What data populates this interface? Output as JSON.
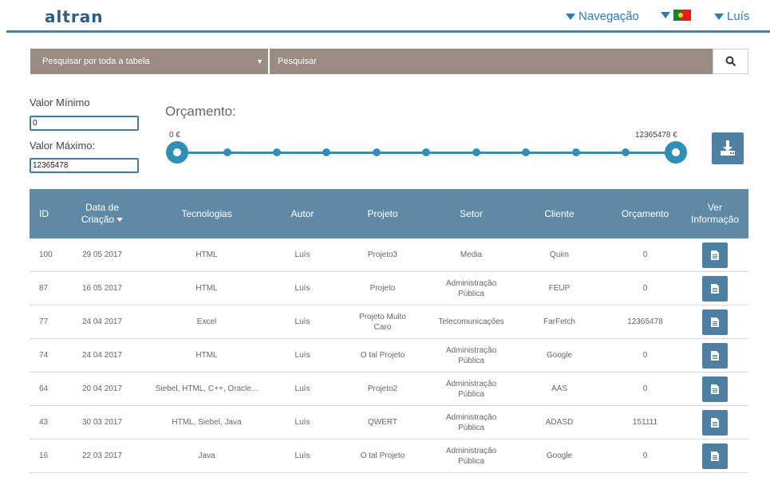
{
  "header": {
    "logo": "altran",
    "nav_label": "Navegação",
    "user_label": "Luís"
  },
  "search": {
    "scope_label": "Pesquisar por toda a tabela",
    "placeholder": "Pesquisar"
  },
  "filters": {
    "min_label": "Valor Mínimo",
    "min_value": "0",
    "max_label": "Valor Máximo:",
    "max_value": "12365478",
    "budget_title": "Orçamento:",
    "range_min_label": "0 €",
    "range_max_label": "12365478 €"
  },
  "table": {
    "columns": {
      "id": "ID",
      "date": "Data de Criação",
      "tech": "Tecnologias",
      "author": "Autor",
      "project": "Projeto",
      "sector": "Setor",
      "client": "Cliente",
      "budget": "Orçamento",
      "info": "Ver Informação"
    },
    "rows": [
      {
        "id": "100",
        "date": "29 05 2017",
        "tech": "HTML",
        "author": "Luís",
        "project": "Projeto3",
        "sector": "Media",
        "client": "Quim",
        "budget": "0"
      },
      {
        "id": "87",
        "date": "16 05 2017",
        "tech": "HTML",
        "author": "Luís",
        "project": "Projeto",
        "sector": "Administração Pública",
        "client": "FEUP",
        "budget": "0"
      },
      {
        "id": "77",
        "date": "24 04 2017",
        "tech": "Excel",
        "author": "Luís",
        "project": "Projeto Muito Caro",
        "sector": "Telecomunicações",
        "client": "FarFetch",
        "budget": "12365478"
      },
      {
        "id": "74",
        "date": "24 04 2017",
        "tech": "HTML",
        "author": "Luís",
        "project": "O tal Projeto",
        "sector": "Administração Pública",
        "client": "Google",
        "budget": "0"
      },
      {
        "id": "64",
        "date": "20 04 2017",
        "tech": "Siebel, HTML, C++, Oracle...",
        "author": "Luís",
        "project": "Projeto2",
        "sector": "Administração Pública",
        "client": "AAS",
        "budget": "0"
      },
      {
        "id": "43",
        "date": "30 03 2017",
        "tech": "HTML, Siebel, Java",
        "author": "Luís",
        "project": "QWERT",
        "sector": "Administração Pública",
        "client": "ADASD",
        "budget": "151111"
      },
      {
        "id": "16",
        "date": "22 03 2017",
        "tech": "Java",
        "author": "Luís",
        "project": "O tal Projeto",
        "sector": "Administração Pública",
        "client": "Google",
        "budget": "0"
      }
    ]
  },
  "colors": {
    "accent": "#2f8fb4",
    "header_bg": "#5f8aa5",
    "search_bg": "#9a8c81",
    "button_bg": "#4f7fa1"
  },
  "icons": {
    "search": "search-icon",
    "download": "download-icon",
    "info": "document-icon",
    "flag": "portugal-flag-icon"
  }
}
